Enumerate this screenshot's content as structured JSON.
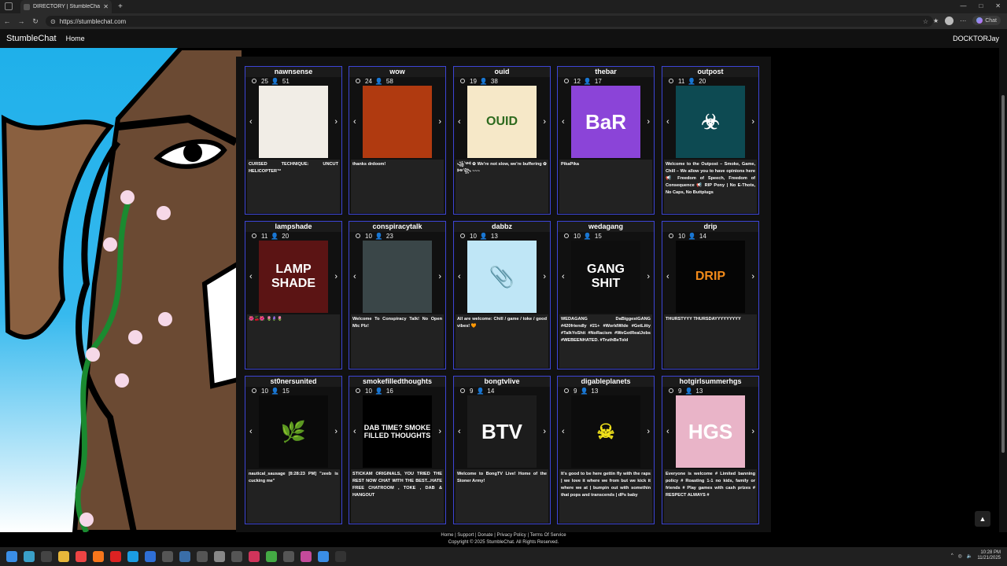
{
  "browser": {
    "tab_title": "DIRECTORY | StumbleChat.com",
    "tab_close": "✕",
    "new_tab": "+",
    "url": "https://stumblechat.com",
    "chat_button": "Chat",
    "window_controls": [
      "—",
      "□",
      "✕"
    ]
  },
  "site": {
    "brand": "StumbleChat",
    "home": "Home",
    "username": "DOCKTORJay"
  },
  "rooms": [
    {
      "name": "nawnsense",
      "users": "25",
      "watchers": "51",
      "desc": "CURSED TECHNIQUE: UNCUT HELICOPTER™",
      "img_text": "",
      "img_bg": "#f1ede6"
    },
    {
      "name": "wow",
      "users": "24",
      "watchers": "58",
      "desc": "thanks drdoom!",
      "img_text": "",
      "img_bg": "#b03a10"
    },
    {
      "name": "ouid",
      "users": "19",
      "watchers": "38",
      "desc": "꧁༺ ✿ We're not slow, we're buffering ✿ ༻꧂ ~~~",
      "img_text": "OUID",
      "img_bg": "#f6e8c8"
    },
    {
      "name": "thebar",
      "users": "12",
      "watchers": "17",
      "desc": "PikaPika",
      "img_text": "BaR",
      "img_bg": "#8b44d8"
    },
    {
      "name": "outpost",
      "users": "11",
      "watchers": "20",
      "desc": "Welcome to the Outpost – Smoke, Game, Chill – We allow you to have opinions here 📢 Freedom of Speech, Freedom of Consequence 📢 RIP Pony | No E-Thots, No Caps, No Buttplugs",
      "img_text": "☣",
      "img_bg": "#0d4a52"
    },
    {
      "name": "lampshade",
      "users": "11",
      "watchers": "20",
      "desc": "🌺🍒🌺 🌷🪻🌷",
      "img_text": "LAMP SHADE",
      "img_bg": "#5b1414"
    },
    {
      "name": "conspiracytalk",
      "users": "10",
      "watchers": "23",
      "desc": "Welcome To Conspiracy Talk! No Open Mic Plz!",
      "img_text": "",
      "img_bg": "#3a4648"
    },
    {
      "name": "dabbz",
      "users": "10",
      "watchers": "13",
      "desc": "All are welcome: Chill / game / toke / good vibes! 🧡",
      "img_text": "📎",
      "img_bg": "#bfe6f6"
    },
    {
      "name": "wedagang",
      "users": "10",
      "watchers": "15",
      "desc": "WEDAGANG DaBiggestGANG #420friendly #21+ #WorldWide #GetLitty #TalkYoShit #NoRacism #WeGotRealJobs #WEBEENHATED. #TruthBeTold",
      "img_text": "GANG SHIT",
      "img_bg": "#0e0e0e"
    },
    {
      "name": "drip",
      "users": "10",
      "watchers": "14",
      "desc": "THURSTYYY THURSDAYYYYYYYYY",
      "img_text": "DRIP",
      "img_bg": "#050505"
    },
    {
      "name": "st0nersunited",
      "users": "10",
      "watchers": "15",
      "desc": "nautical_sausage [8:28:23 PM] \"zeeb is cucking me\"",
      "img_text": "🌿",
      "img_bg": "#0a0a0a"
    },
    {
      "name": "smokefilledthoughts",
      "users": "10",
      "watchers": "16",
      "desc": "STICKAM ORIGINALS, YOU TRIED THE REST NOW CHAT WITH THE BEST...HATE FREE CHATROOM , TOKE , DAB & HANGOUT",
      "img_text": "DAB TIME? SMOKE FILLED THOUGHTS",
      "img_bg": "#000000"
    },
    {
      "name": "bongtvlive",
      "users": "9",
      "watchers": "14",
      "desc": "Welcome to BongTV Live! Home of the Stoner Army!",
      "img_text": "BTV",
      "img_bg": "#1c1c1c"
    },
    {
      "name": "digableplanets",
      "users": "9",
      "watchers": "13",
      "desc": "It's good to be here gettin fly with the raps | we love it where we from but we kick it where we at | bumpin out with somethin that pops and transcends | dPs baby",
      "img_text": "☠",
      "img_bg": "#0c0c0c"
    },
    {
      "name": "hotgirlsummerhgs",
      "users": "9",
      "watchers": "13",
      "desc": "Everyone is welcome # Limited banning policy # Roasting 1-1 no kids, family or friends # Play games with cash prizes # RESPECT ALWAYS #",
      "img_text": "HGS",
      "img_bg": "#e9b4c8"
    }
  ],
  "footer": {
    "links": "Home | Support | Donate | Privacy Policy | Terms Of Service",
    "copyright": "Copyright © 2025 StumbleChat. All Rights Reserved."
  },
  "to_top": "▲",
  "taskbar": {
    "time": "10:28 PM",
    "date": "11/21/2025"
  },
  "colors": {
    "card_border": "#3d45d6",
    "accent_blue": "#1fb0ea"
  }
}
